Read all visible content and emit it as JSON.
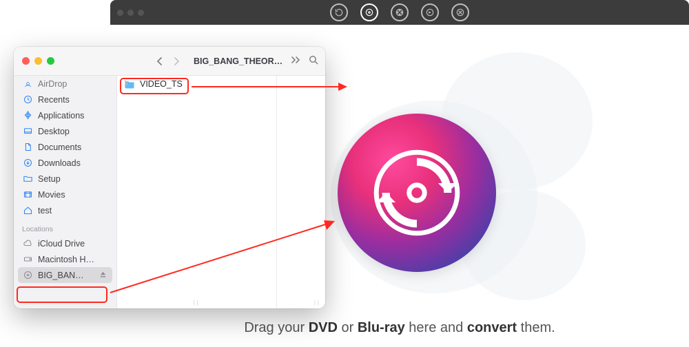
{
  "app": {
    "caption_parts": {
      "t1": "Drag your ",
      "b1": "DVD",
      "t2": " or ",
      "b2": "Blu-ray",
      "t3": " here and ",
      "b3": "convert",
      "t4": " them."
    }
  },
  "finder": {
    "title": "BIG_BANG_THEOR…",
    "sidebar": {
      "items": [
        {
          "label": "AirDrop"
        },
        {
          "label": "Recents"
        },
        {
          "label": "Applications"
        },
        {
          "label": "Desktop"
        },
        {
          "label": "Documents"
        },
        {
          "label": "Downloads"
        },
        {
          "label": "Setup"
        },
        {
          "label": "Movies"
        },
        {
          "label": "test"
        }
      ],
      "section_label": "Locations",
      "locations": [
        {
          "label": "iCloud Drive"
        },
        {
          "label": "Macintosh H…"
        },
        {
          "label": "BIG_BAN…"
        }
      ]
    },
    "content": {
      "item_label": "VIDEO_TS"
    }
  }
}
